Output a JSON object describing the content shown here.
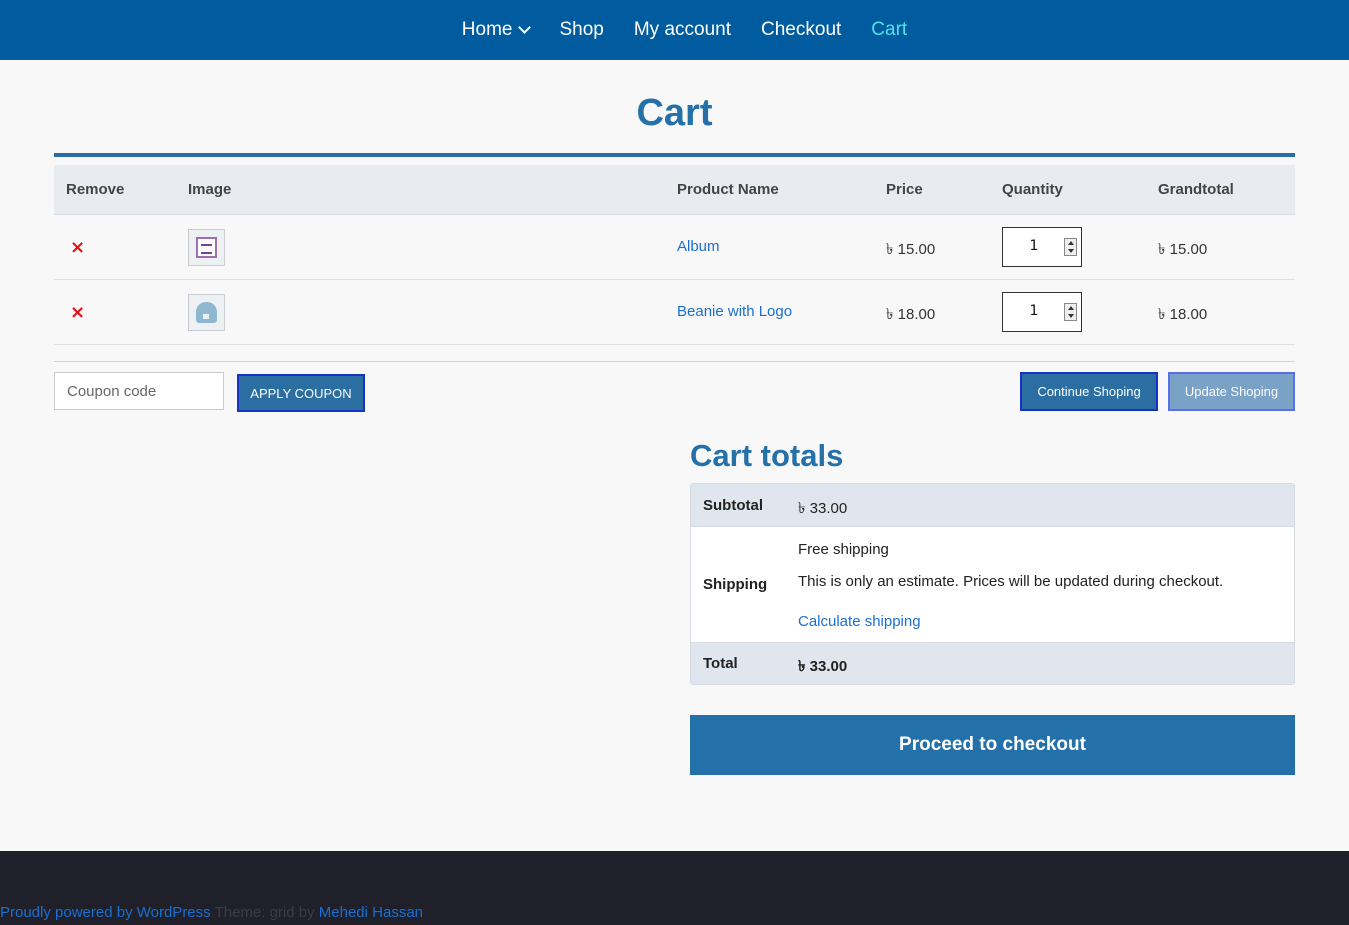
{
  "nav": {
    "items": [
      {
        "label": "Home"
      },
      {
        "label": "Shop"
      },
      {
        "label": "My account"
      },
      {
        "label": "Checkout"
      },
      {
        "label": "Cart"
      }
    ]
  },
  "page": {
    "title": "Cart"
  },
  "table": {
    "headers": {
      "remove": "Remove",
      "image": "Image",
      "product": "Product Name",
      "price": "Price",
      "quantity": "Quantity",
      "grandtotal": "Grandtotal"
    },
    "rows": [
      {
        "remove": "×",
        "product": "Album",
        "price": "৳ 15.00",
        "quantity": "1",
        "grandtotal": "৳ 15.00"
      },
      {
        "remove": "×",
        "product": "Beanie with Logo",
        "price": "৳ 18.00",
        "quantity": "1",
        "grandtotal": "৳ 18.00"
      }
    ]
  },
  "actions": {
    "coupon_placeholder": "Coupon code",
    "apply_coupon": "APPLY COUPON",
    "continue": "Continue Shoping",
    "update": "Update Shoping"
  },
  "totals": {
    "title": "Cart totals",
    "subtotal_label": "Subtotal",
    "subtotal_value": "৳ 33.00",
    "shipping_label": "Shipping",
    "shipping_method": "Free shipping",
    "shipping_note": "This is only an estimate. Prices will be updated during checkout.",
    "calculate_link": "Calculate shipping",
    "total_label": "Total",
    "total_value": "৳ 33.00",
    "checkout_button": "Proceed to checkout"
  },
  "footer": {
    "powered": "Proudly powered by WordPress",
    "separator": "Theme: grid by",
    "author": "Mehedi Hassan"
  },
  "colors": {
    "nav_bg": "#005b9f",
    "accent": "#2371a8",
    "active_nav": "#4fe3ea",
    "link": "#1a6fd1",
    "remove": "#e21111",
    "footer_bg": "#1f2029"
  }
}
